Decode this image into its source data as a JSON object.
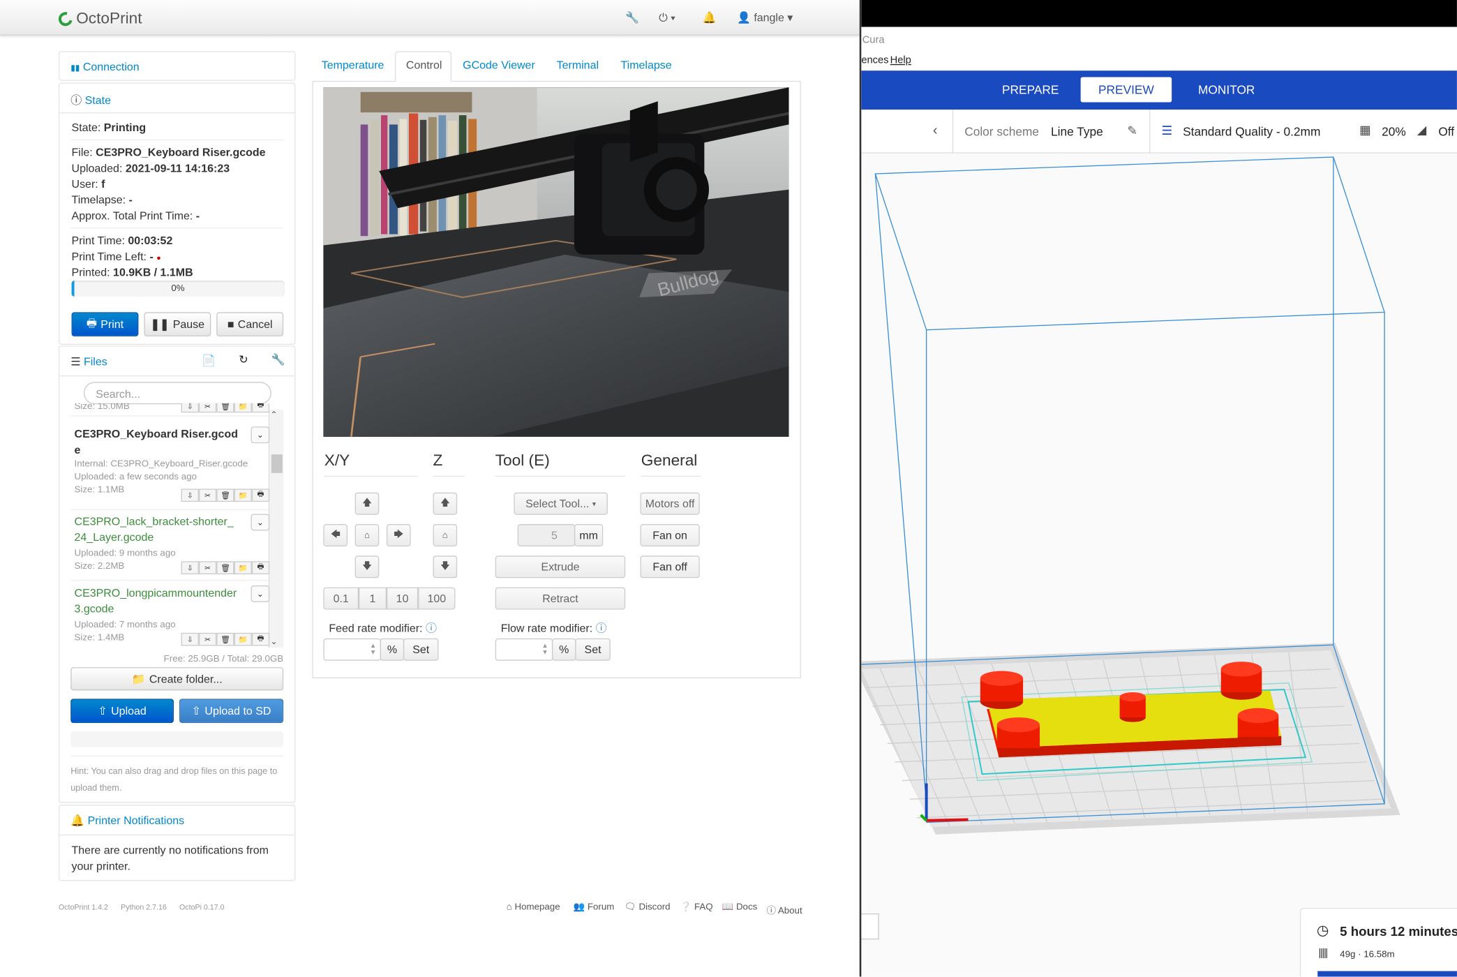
{
  "octoprint": {
    "brand": "OctoPrint",
    "nav": {
      "user": "fangle"
    },
    "connection": {
      "title": "Connection"
    },
    "state": {
      "title": "State",
      "state_label": "State:",
      "state_value": "Printing",
      "file_label": "File:",
      "file_value": "CE3PRO_Keyboard Riser.gcode",
      "uploaded_label": "Uploaded:",
      "uploaded_value": "2021-09-11 14:16:23",
      "user_label": "User:",
      "user_value": "f",
      "timelapse_label": "Timelapse:",
      "timelapse_value": "-",
      "approx_label": "Approx. Total Print Time:",
      "approx_value": "-",
      "print_time_label": "Print Time:",
      "print_time_value": "00:03:52",
      "time_left_label": "Print Time Left:",
      "time_left_value": "-",
      "printed_label": "Printed:",
      "printed_value": "10.9KB / 1.1MB",
      "progress_text": "0%",
      "progress": 0.01,
      "print_btn": "Print",
      "pause_btn": "Pause",
      "cancel_btn": "Cancel"
    },
    "files": {
      "title": "Files",
      "search_placeholder": "Search...",
      "cut_size": "Size: 15.0MB",
      "items": [
        {
          "name": "CE3PRO_Keyboard Riser.gcod",
          "name2": "e",
          "internal": "Internal: CE3PRO_Keyboard_Riser.gcode",
          "uploaded": "Uploaded: a few seconds ago",
          "size": "Size: 1.1MB"
        },
        {
          "name": "CE3PRO_lack_bracket-shorter_",
          "name2": "24_Layer.gcode",
          "uploaded": "Uploaded: 9 months ago",
          "size": "Size: 2.2MB"
        },
        {
          "name": "CE3PRO_longpicammountender",
          "name2": "3.gcode",
          "uploaded": "Uploaded: 7 months ago",
          "size": "Size: 1.4MB"
        }
      ],
      "free": "Free: 25.9GB / Total: 29.0GB",
      "create_folder": "Create folder...",
      "upload": "Upload",
      "upload_sd": "Upload to SD",
      "hint": "Hint: You can also drag and drop files on this page to upload them."
    },
    "notifications": {
      "title": "Printer Notifications",
      "text": "There are currently no notifications from your printer."
    },
    "tabs": [
      "Temperature",
      "Control",
      "GCode Viewer",
      "Terminal",
      "Timelapse"
    ],
    "control": {
      "xy": "X/Y",
      "z": "Z",
      "tool": "Tool (E)",
      "general": "General",
      "steps": [
        "0.1",
        "1",
        "10",
        "100"
      ],
      "select_tool": "Select Tool...",
      "extrude_amount": "5",
      "mm": "mm",
      "extrude": "Extrude",
      "retract": "Retract",
      "motors_off": "Motors off",
      "fan_on": "Fan on",
      "fan_off": "Fan off",
      "feed_rate": "Feed rate modifier:",
      "flow_rate": "Flow rate modifier:",
      "percent": "%",
      "set": "Set"
    },
    "footer": {
      "version": "OctoPrint 1.4.2",
      "python": "Python 2.7.16",
      "octopi": "OctoPi 0.17.0",
      "links": [
        "Homepage",
        "Forum",
        "Discord",
        "FAQ",
        "Docs",
        "About"
      ]
    }
  },
  "cura": {
    "title": "Cura",
    "menu_a": "ences",
    "menu_b": "Help",
    "stages": [
      "PREPARE",
      "PREVIEW",
      "MONITOR"
    ],
    "active_stage": "PREVIEW",
    "color_scheme_label": "Color scheme",
    "color_scheme_value": "Line Type",
    "quality": "Standard Quality - 0.2mm",
    "infill": "20%",
    "support": "Off",
    "print_time": "5 hours 12 minutes",
    "material": "49g · 16.58m",
    "colors": {
      "stage_bar": "#1a4abf",
      "model_top": "#e8e000",
      "model_wall": "#ee1c00"
    }
  }
}
